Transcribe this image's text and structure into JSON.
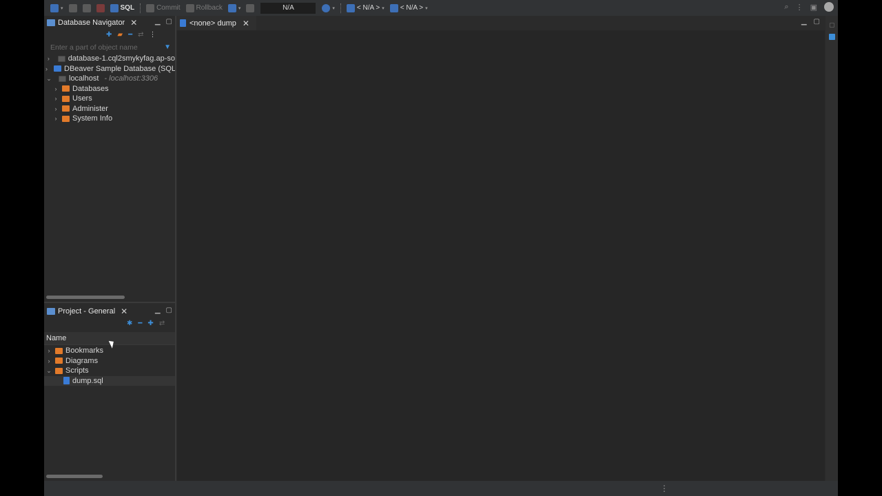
{
  "toolbar": {
    "sql_label": "SQL",
    "commit_label": "Commit",
    "rollback_label": "Rollback",
    "tx_box": "N/A",
    "datasource": "< N/A >",
    "schema": "< N/A >"
  },
  "navigator": {
    "title": "Database Navigator",
    "search_placeholder": "Enter a part of object name",
    "items": [
      {
        "label": "database-1.cql2smykyfag.ap-so",
        "extra": ""
      },
      {
        "label": "DBeaver Sample Database (SQL",
        "extra": ""
      },
      {
        "label": "localhost",
        "extra": "- localhost:3306"
      }
    ],
    "children": [
      "Databases",
      "Users",
      "Administer",
      "System Info"
    ]
  },
  "project": {
    "title": "Project - General",
    "column_header": "Name",
    "items": [
      "Bookmarks",
      "Diagrams",
      "Scripts"
    ],
    "script_file": "dump.sql"
  },
  "editor": {
    "tab_label": "<none> dump"
  },
  "colors": {
    "accent": "#3d8ed8",
    "folder": "#e27a2a",
    "background": "#2b2b2b"
  }
}
